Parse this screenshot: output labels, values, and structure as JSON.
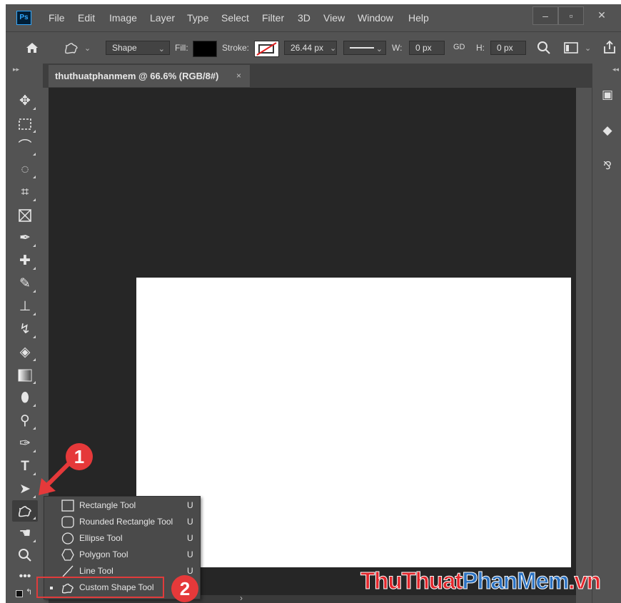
{
  "app": {
    "logo": "Ps"
  },
  "menubar": {
    "items": [
      "File",
      "Edit",
      "Image",
      "Layer",
      "Type",
      "Select",
      "Filter",
      "3D",
      "View",
      "Window",
      "Help"
    ]
  },
  "window_controls": {
    "minimize": "‒",
    "restore": "▫",
    "close": "✕"
  },
  "options": {
    "mode": "Shape",
    "fill_label": "Fill:",
    "fill_color": "#000000",
    "stroke_label": "Stroke:",
    "stroke_size": "26.44 px",
    "w_label": "W:",
    "w_value": "0 px",
    "link_icon": "GD",
    "h_label": "H:",
    "h_value": "0 px"
  },
  "document_tab": {
    "title": "thuthuatphanmem @ 66.6% (RGB/8#)",
    "close": "×"
  },
  "flyout": {
    "items": [
      {
        "label": "Rectangle Tool",
        "key": "U",
        "icon": "rectangle-icon"
      },
      {
        "label": "Rounded Rectangle Tool",
        "key": "U",
        "icon": "rounded-rectangle-icon"
      },
      {
        "label": "Ellipse Tool",
        "key": "U",
        "icon": "ellipse-icon"
      },
      {
        "label": "Polygon Tool",
        "key": "U",
        "icon": "polygon-icon"
      },
      {
        "label": "Line Tool",
        "key": "U",
        "icon": "line-icon"
      },
      {
        "label": "Custom Shape Tool",
        "key": "U",
        "icon": "custom-shape-icon"
      }
    ]
  },
  "callouts": {
    "one": "1",
    "two": "2"
  },
  "watermark": {
    "part1": "Thu",
    "part2": "Thuat",
    "part3": "PhanMem",
    "part4": ".vn"
  },
  "colors": {
    "highlight": "#e03b3b",
    "callout": "#e5393a",
    "canvas": "#ffffff",
    "workspace": "#262626"
  }
}
